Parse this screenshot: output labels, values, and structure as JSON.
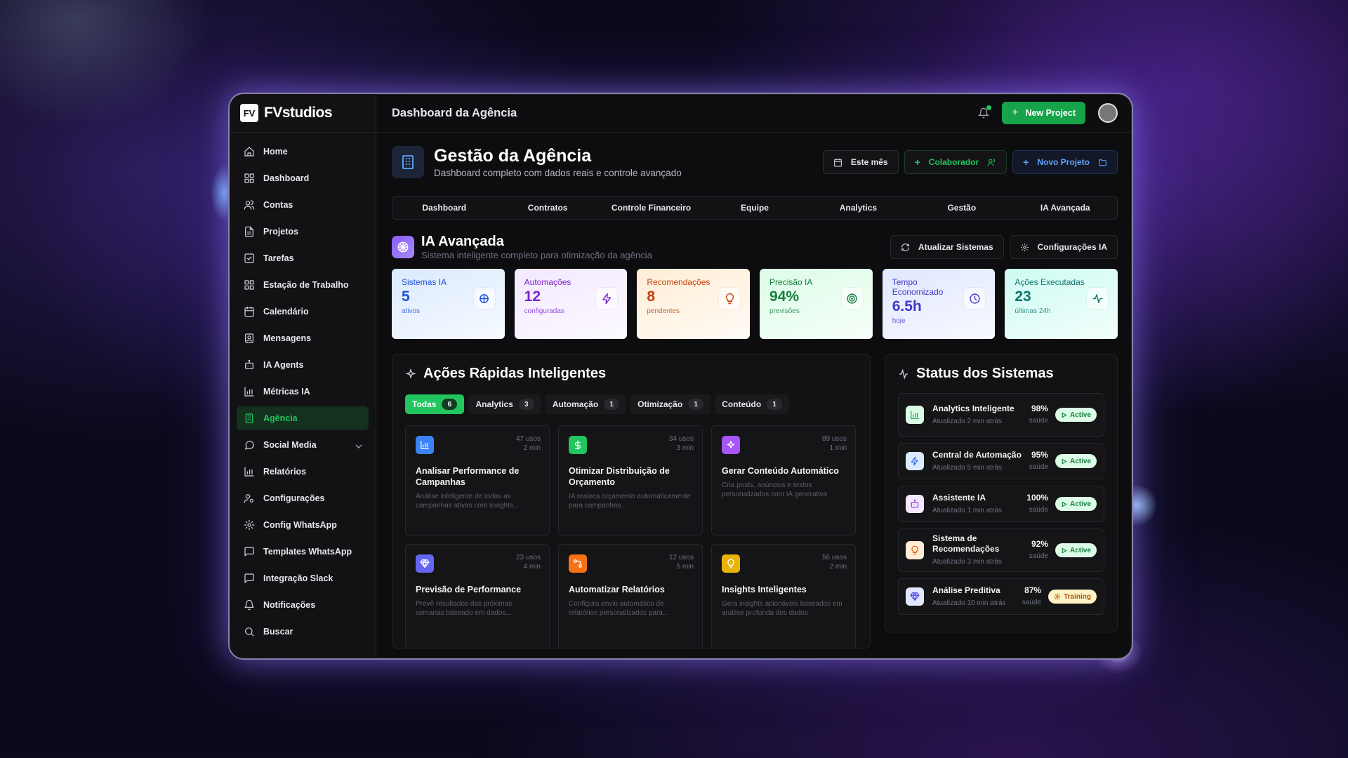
{
  "app": {
    "logo_mark": "FV",
    "name": "FVstudios"
  },
  "sidebar": {
    "items": [
      {
        "label": "Home",
        "icon": "home-icon"
      },
      {
        "label": "Dashboard",
        "icon": "grid-icon"
      },
      {
        "label": "Contas",
        "icon": "users-icon"
      },
      {
        "label": "Projetos",
        "icon": "file-icon"
      },
      {
        "label": "Tarefas",
        "icon": "check-square-icon"
      },
      {
        "label": "Estação de Trabalho",
        "icon": "grid-icon"
      },
      {
        "label": "Calendário",
        "icon": "calendar-icon"
      },
      {
        "label": "Mensagens",
        "icon": "message-icon"
      },
      {
        "label": "IA Agents",
        "icon": "bot-icon"
      },
      {
        "label": "Métricas IA",
        "icon": "bar-chart-icon"
      },
      {
        "label": "Agência",
        "icon": "building-icon",
        "active": true
      },
      {
        "label": "Social Media",
        "icon": "chat-bubble-icon",
        "expandable": true
      },
      {
        "label": "Relatórios",
        "icon": "bar-chart-icon"
      },
      {
        "label": "Configurações",
        "icon": "user-cog-icon"
      },
      {
        "label": "Config WhatsApp",
        "icon": "gear-icon"
      },
      {
        "label": "Templates WhatsApp",
        "icon": "message-square-icon"
      },
      {
        "label": "Integração Slack",
        "icon": "message-square-icon"
      },
      {
        "label": "Notificações",
        "icon": "bell-icon"
      },
      {
        "label": "Buscar",
        "icon": "search-icon"
      }
    ]
  },
  "topbar": {
    "title": "Dashboard da Agência",
    "new_project": "New Project"
  },
  "header": {
    "title": "Gestão da Agência",
    "subtitle": "Dashboard completo com dados reais e controle avançado",
    "period_button": "Este mês",
    "collaborator_button": "Colaborador",
    "new_project_button": "Novo Projeto"
  },
  "tabs": [
    "Dashboard",
    "Contratos",
    "Controle Financeiro",
    "Equipe",
    "Analytics",
    "Gestão",
    "IA Avançada"
  ],
  "ia": {
    "title": "IA Avançada",
    "subtitle": "Sistema inteligente completo para otimização da agência",
    "refresh_button": "Atualizar Sistemas",
    "settings_button": "Configurações IA"
  },
  "stats": [
    {
      "label": "Sistemas IA",
      "value": "5",
      "sub": "ativos",
      "icon": "brain-icon",
      "bg": "#dbeafe",
      "color": "#1d4ed8"
    },
    {
      "label": "Automações",
      "value": "12",
      "sub": "configuradas",
      "icon": "lightning-icon",
      "bg": "#f3e8ff",
      "color": "#7e22ce"
    },
    {
      "label": "Recomendações",
      "value": "8",
      "sub": "pendentes",
      "icon": "lightbulb-icon",
      "bg": "#ffedd5",
      "color": "#c2410c"
    },
    {
      "label": "Precisão IA",
      "value": "94%",
      "sub": "previsões",
      "icon": "target-icon",
      "bg": "#dcfce7",
      "color": "#15803d"
    },
    {
      "label": "Tempo Economizado",
      "value": "6.5h",
      "sub": "hoje",
      "icon": "clock-icon",
      "bg": "#e0e7ff",
      "color": "#4338ca"
    },
    {
      "label": "Ações Executadas",
      "value": "23",
      "sub": "últimas 24h",
      "icon": "activity-icon",
      "bg": "#ccfbf1",
      "color": "#0f766e"
    }
  ],
  "quick_actions": {
    "title": "Ações Rápidas Inteligentes",
    "filters": [
      {
        "label": "Todas",
        "count": "6",
        "active": true
      },
      {
        "label": "Analytics",
        "count": "3"
      },
      {
        "label": "Automação",
        "count": "1"
      },
      {
        "label": "Otimização",
        "count": "1"
      },
      {
        "label": "Conteúdo",
        "count": "1"
      }
    ],
    "cards": [
      {
        "title": "Analisar Performance de Campanhas",
        "desc": "Análise inteligente de todas as campanhas ativas com insights...",
        "uses": "47 usos",
        "time": "2 min",
        "icon": "bar-chart-icon",
        "color": "#3b82f6"
      },
      {
        "title": "Otimizar Distribuição de Orçamento",
        "desc": "IA realoca orçamento automaticamente para campanhas...",
        "uses": "34 usos",
        "time": "3 min",
        "icon": "dollar-icon",
        "color": "#22c55e"
      },
      {
        "title": "Gerar Conteúdo Automático",
        "desc": "Cria posts, anúncios e textos personalizados com IA generativa",
        "uses": "89 usos",
        "time": "1 min",
        "icon": "sparkle-icon",
        "color": "#a855f7"
      },
      {
        "title": "Previsão de Performance",
        "desc": "Prevê resultados das próximas semanas baseado em dados...",
        "uses": "23 usos",
        "time": "4 min",
        "icon": "gem-icon",
        "color": "#6366f1"
      },
      {
        "title": "Automatizar Relatórios",
        "desc": "Configura envio automático de relatórios personalizados para...",
        "uses": "12 usos",
        "time": "5 min",
        "icon": "workflow-icon",
        "color": "#f97316"
      },
      {
        "title": "Insights Inteligentes",
        "desc": "Gera insights acionáveis baseados em análise profunda dos dados",
        "uses": "56 usos",
        "time": "2 min",
        "icon": "lightbulb-icon",
        "color": "#eab308"
      }
    ]
  },
  "systems": {
    "title": "Status dos Sistemas",
    "items": [
      {
        "name": "Analytics Inteligente",
        "updated": "Atualizado 2 min atrás",
        "pct": "98%",
        "health": "saúde",
        "status": "Active",
        "icon": "bar-chart-icon",
        "bg": "#dcfce7",
        "color": "#16a34a"
      },
      {
        "name": "Central de Automação",
        "updated": "Atualizado 5 min atrás",
        "pct": "95%",
        "health": "saúde",
        "status": "Active",
        "icon": "lightning-icon",
        "bg": "#dbeafe",
        "color": "#2563eb"
      },
      {
        "name": "Assistente IA",
        "updated": "Atualizado 1 min atrás",
        "pct": "100%",
        "health": "saúde",
        "status": "Active",
        "icon": "bot-icon",
        "bg": "#f3e8ff",
        "color": "#9333ea"
      },
      {
        "name": "Sistema de Recomendações",
        "updated": "Atualizado 3 min atrás",
        "pct": "92%",
        "health": "saúde",
        "status": "Active",
        "icon": "lightbulb-icon",
        "bg": "#ffedd5",
        "color": "#ea580c"
      },
      {
        "name": "Análise Preditiva",
        "updated": "Atualizado 10 min atrás",
        "pct": "87%",
        "health": "saúde",
        "status": "Training",
        "icon": "gem-icon",
        "bg": "#e0e7ff",
        "color": "#4f46e5"
      }
    ]
  }
}
